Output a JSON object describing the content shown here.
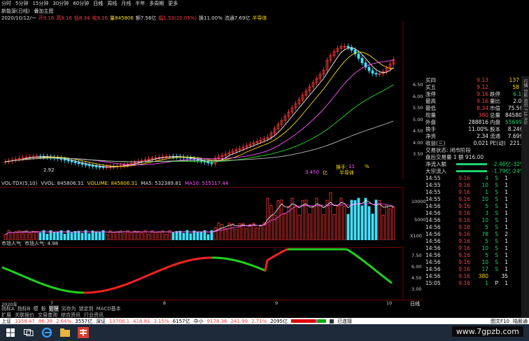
{
  "toolbar": {
    "items": [
      "分时",
      "5分钟",
      "15分钟",
      "30分钟",
      "60分钟",
      "日线",
      "周线",
      "月线",
      "半年",
      "多周期",
      "更多"
    ]
  },
  "title": {
    "name": "新能源(日线)",
    "indicator": "叠加主图"
  },
  "info": {
    "date": "2020/10/12/一",
    "open": "开9.16",
    "high": "高9.16",
    "low": "低8.34",
    "close": "收9.16",
    "volume": "量845806",
    "amount": "额7.56亿",
    "amplitude": "幅1.53(20.05%)",
    "turnover": "换11.00%",
    "float": "流通7.69亿",
    "sector": "半导体"
  },
  "main_axis_ticks": [
    "6.50",
    "6.00",
    "5.50",
    "5.00",
    "4.50",
    "4.00",
    "3.50"
  ],
  "annot": {
    "low_mark": "2.92",
    "amount_mark": "3.450",
    "amount_unit": "亿",
    "turnover_label": "换手：",
    "turnover_value": "11",
    "pct": "%",
    "sector_tag": "半导体"
  },
  "vol": {
    "name": "VOL-TDX(5,10)",
    "vvol": "VVOL: 845806.31",
    "volume": "VOLUME: 845806.31",
    "ma5": "MA5: 532389.81",
    "ma10": "MA10: 515117.44",
    "ticks": [
      "10000",
      "5000"
    ],
    "unit": "X100"
  },
  "pop": {
    "name": "市场人气",
    "value_label": "市场人气: 4.98",
    "ticks": [
      "7.50",
      "6.00",
      "4.50",
      "3.00"
    ]
  },
  "xaxis": {
    "labels": [
      "2020年",
      "7",
      "8",
      "9",
      "10"
    ],
    "period": "日线"
  },
  "tabs": [
    "指标A",
    "指标B",
    "模",
    "板",
    "管理",
    "另存为",
    "锁定到",
    "MACD基本"
  ],
  "tabs2": [
    "扩展",
    "关联报价",
    "交易查询",
    "综合资讯",
    "行业资讯"
  ],
  "ticker": {
    "idx1_name": "上证",
    "idx1_val": "3358.47",
    "idx1_chg": "86.39",
    "idx1_pct": "2.64%",
    "idx1_amt": "3557亿",
    "idx2_name": "深证",
    "idx2_val": "13708.1",
    "idx2_chg": "418.81",
    "idx2_pct": "3.15%",
    "idx2_amt": "6157亿",
    "idx3_name": "中小",
    "idx3_val": "9178.36",
    "idx3_chg": "241.99",
    "idx3_pct": "2.71%",
    "idx3_amt": "2095亿",
    "conn": "已连接",
    "right1": "图文F10",
    "right2": "陆股通"
  },
  "watermark": "www.7gpzb.com",
  "quote": {
    "rows": [
      {
        "label": "买四",
        "val": "9.13",
        "extra": "137",
        "c": "red"
      },
      {
        "label": "买五",
        "val": "9.12",
        "extra": "58",
        "c": "red"
      },
      {
        "label": "涨停",
        "val": "9.16",
        "k2": "跌停",
        "v2": "6.10"
      },
      {
        "label": "最高",
        "val": "9.16",
        "k2": "量比",
        "v2": "2.00"
      },
      {
        "label": "最低",
        "val": "8.34",
        "k2": "市值",
        "v2": "75.5亿"
      },
      {
        "label": "现量",
        "val": "380",
        "k2": "总量",
        "v2": "845806"
      },
      {
        "label": "外盘",
        "val": "288816",
        "k2": "内盘",
        "v2": "556990"
      },
      {
        "label": "换手",
        "val": "11.00%",
        "k2": "股本",
        "v2": "8.24亿"
      },
      {
        "label": "净资",
        "val": "2.34",
        "k2": "流通",
        "v2": "7.69亿"
      },
      {
        "label": "收益(三)",
        "val": "0.021",
        "k2": "PE(动)",
        "v2": "221.2"
      }
    ],
    "status1": "交易状态: 闭市阶段",
    "status2": "盘后交易量 1 额 916.00",
    "flow": [
      {
        "label": "净流入额",
        "val": "-2.46亿",
        "pct": "-32%"
      },
      {
        "label": "大宗流入",
        "val": "-1.79亿",
        "pct": "-24%"
      }
    ],
    "ticks": [
      {
        "t": "14:55",
        "p": "9.16",
        "v": "4",
        "s": "S",
        "n": "1"
      },
      {
        "t": "14:55",
        "p": "9.16",
        "v": "10",
        "s": "S",
        "n": "1"
      },
      {
        "t": "14:55",
        "p": "9.16",
        "v": "1",
        "s": "S",
        "n": "1"
      },
      {
        "t": "14:55",
        "p": "9.16",
        "v": "10",
        "s": "S",
        "n": "1"
      },
      {
        "t": "14:56",
        "p": "9.16",
        "v": "5",
        "s": "S",
        "n": "1"
      },
      {
        "t": "14:56",
        "p": "9.16",
        "v": "3",
        "s": "S",
        "n": "1"
      },
      {
        "t": "14:56",
        "p": "9.16",
        "v": "10",
        "s": "S",
        "n": "1"
      },
      {
        "t": "14:56",
        "p": "9.16",
        "v": "5",
        "s": "S",
        "n": "1"
      },
      {
        "t": "14:56",
        "p": "9.16",
        "v": "78",
        "s": "S",
        "n": "2"
      },
      {
        "t": "14:56",
        "p": "9.16",
        "v": "5",
        "s": "S",
        "n": "1"
      },
      {
        "t": "14:56",
        "p": "9.16",
        "v": "10",
        "s": "S",
        "n": "1"
      },
      {
        "t": "14:56",
        "p": "9.16",
        "v": "5",
        "s": "S",
        "n": "1"
      },
      {
        "t": "14:56",
        "p": "9.16",
        "v": "10",
        "s": "S",
        "n": "1"
      },
      {
        "t": "14:56",
        "p": "9.16",
        "v": "17",
        "s": "S",
        "n": "1"
      },
      {
        "t": "14:56",
        "p": "9.16",
        "v": "380",
        "s": "",
        "n": "35"
      },
      {
        "t": "15:05",
        "p": "9.16",
        "v": "1",
        "s": "P",
        "n": "1"
      }
    ]
  },
  "strip": [
    "行情",
    "分析",
    "资讯",
    "F10",
    "RSI"
  ],
  "colors": {
    "up": "#ff3a3a",
    "down": "#40e0ff",
    "ma1": "#ffffff",
    "ma2": "#ffdd00",
    "ma3": "#ff55ff",
    "ma4": "#22dd22"
  }
}
